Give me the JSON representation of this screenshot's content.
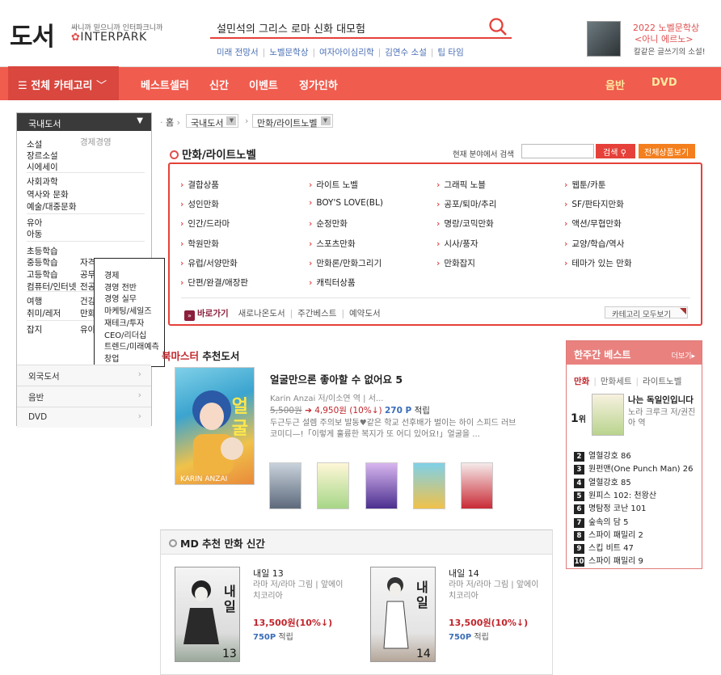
{
  "header": {
    "logo_main": "도서",
    "logo_tag": "싸니까 믿으니까 인터파크니까",
    "logo_brand": "INTERPARK",
    "search_value": "설민석의 그리스 로마 신화 대모험",
    "hot_keywords": [
      "미래 전망서",
      "노벨문학상",
      "여자아이심리학",
      "김연수 소설",
      "팁 타임"
    ],
    "promo": {
      "line1": "2022 노벨문학상",
      "line2": "<아니 에르노>",
      "line3": "칼같은 글쓰기의 소설!"
    }
  },
  "nav": {
    "all_categories": "전체 카테고리",
    "items": [
      "베스트셀러",
      "신간",
      "이벤트",
      "정가인하"
    ],
    "right_items": [
      "음반",
      "DVD"
    ]
  },
  "left_cat": {
    "head": "국내도서",
    "col1": [
      "소설",
      "장르소설",
      "시에세이",
      "사회과학",
      "역사와 문화",
      "예술/대중문화",
      "유아",
      "아동",
      "초등학습",
      "중등학습",
      "고등학습",
      "컴퓨터/인터넷",
      "여행",
      "취미/레저",
      "잡지"
    ],
    "col2": [
      "경제경영",
      "자격서/수험서",
      "공무원 수험서",
      "전공/대학교재",
      "건강/뷰티",
      "만화/라이트노벨",
      "유아동전집"
    ],
    "sub": [
      "경제",
      "경영 전반",
      "경영 실무",
      "마케팅/세일즈",
      "재테크/투자",
      "CEO/리더십",
      "트렌드/미래예측",
      "창업"
    ],
    "foot": [
      "외국도서",
      "음반",
      "DVD"
    ]
  },
  "breadcrumb": {
    "home": "홈",
    "level1": "국내도서",
    "level2": "만화/라이트노벨"
  },
  "category": {
    "title": "만화/라이트노벨",
    "search_label": "현재 분야에서 검색",
    "search_btn": "검색",
    "all_btn": "전체상품보기",
    "links": [
      [
        "결합상품",
        "라이트 노벨",
        "그래픽 노블",
        "웹툰/카툰"
      ],
      [
        "성인만화",
        "BOY'S LOVE(BL)",
        "공포/퇴마/추리",
        "SF/판타지만화"
      ],
      [
        "인간/드라마",
        "순정만화",
        "명랑/코믹만화",
        "액션/무협만화"
      ],
      [
        "학원만화",
        "스포츠만화",
        "시사/풍자",
        "교양/학습/역사"
      ],
      [
        "유럽/서양만화",
        "만화론/만화그리기",
        "만화잡지",
        "테마가 있는 만화"
      ],
      [
        "단편/완결/애장판",
        "캐릭터상품"
      ]
    ],
    "quick_label": "바로가기",
    "quick_links": [
      "새로나온도서",
      "주간베스트",
      "예약도서"
    ],
    "show_all": "카테고리 모두보기"
  },
  "bookmaster": {
    "title_red": "북마스터",
    "title_rest": " 추천도서",
    "book": {
      "title": "얼굴만으론 좋아할 수 없어요 5",
      "author": "Karin Anzai 저/이소연 역 | 서...",
      "orig_price": "5,500원",
      "sale_price": "4,950원 (10%↓)",
      "point": "270 P",
      "point_suffix": "적립",
      "desc": "두근두근 설렘 주의보 발동♥같은 학교 선후배가 벌이는 하이 스피드 러브 코미디—!「이렇게 훌륭한 복지가 또 어디 있어요!」얼굴을 ..."
    }
  },
  "weekly": {
    "title": "한주간 베스트",
    "more": "더보기",
    "tabs": [
      "만화",
      "만화세트",
      "라이트노벨"
    ],
    "rank1": {
      "rank": "1",
      "unit": "위",
      "title": "나는 독일인입니다",
      "author": "노라 크루크 저/권진아 역"
    },
    "list": [
      {
        "n": "2",
        "t": "열혈강호 86"
      },
      {
        "n": "3",
        "t": "원펀맨(One Punch Man) 26"
      },
      {
        "n": "4",
        "t": "열혈강호 85"
      },
      {
        "n": "5",
        "t": "원피스 102: 천왕산"
      },
      {
        "n": "6",
        "t": "명탐정 코난 101"
      },
      {
        "n": "7",
        "t": "숲속의 담 5"
      },
      {
        "n": "8",
        "t": "스파이 패밀리 2"
      },
      {
        "n": "9",
        "t": "스킵 비트 47"
      },
      {
        "n": "10",
        "t": "스파이 패밀리 9"
      }
    ]
  },
  "md": {
    "title": "MD 추천 만화 신간",
    "books": [
      {
        "title": "내일 13",
        "author": "라마 저/라마 그림 | 앞에이치코리아",
        "price": "13,500원(10%↓)",
        "point": "750P",
        "point_suffix": "적립",
        "cover_num": "13",
        "cover_word": "내일"
      },
      {
        "title": "내일 14",
        "author": "라마 저/라마 그림 | 앞에이치코리아",
        "price": "13,500원(10%↓)",
        "point": "750P",
        "point_suffix": "적립",
        "cover_num": "14",
        "cover_word": "내일"
      }
    ]
  },
  "colors": {
    "brand_red": "#f05c4e",
    "accent": "#e5413a",
    "orange": "#f47f1e"
  }
}
